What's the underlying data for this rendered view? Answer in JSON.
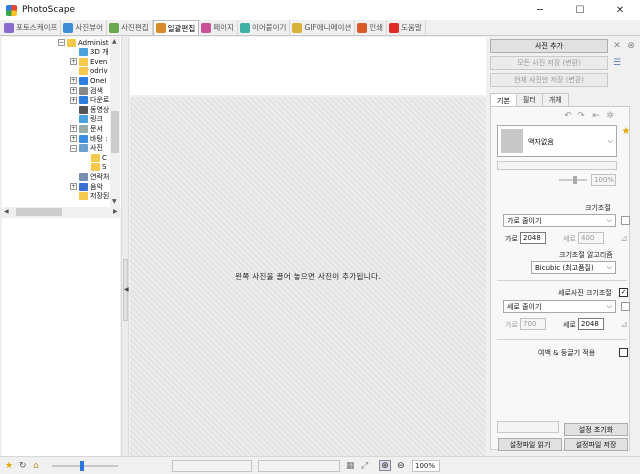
{
  "window": {
    "title": "PhotoScape",
    "minimize": "─",
    "maximize": "☐",
    "close": "✕"
  },
  "tabs": [
    {
      "label": "포토스케이프",
      "color": "#8a6bd0",
      "active": false
    },
    {
      "label": "사진뷰어",
      "color": "#3f8fd8",
      "active": false
    },
    {
      "label": "사진편집",
      "color": "#6aa84f",
      "active": false
    },
    {
      "label": "일괄편집",
      "color": "#d98a2a",
      "active": true
    },
    {
      "label": "페이지",
      "color": "#c94f9a",
      "active": false
    },
    {
      "label": "이어붙이기",
      "color": "#3fb0a8",
      "active": false
    },
    {
      "label": "GIF애니메이션",
      "color": "#d8b23a",
      "active": false
    },
    {
      "label": "인쇄",
      "color": "#d95a2a",
      "active": false
    },
    {
      "label": "도움말",
      "color": "#e02a2a",
      "active": false
    }
  ],
  "tree": {
    "items": [
      {
        "label": "Administ",
        "expander": "−",
        "icon": "user-folder-icon"
      },
      {
        "label": "3D 개",
        "expander": "",
        "icon": "3d-objects-icon"
      },
      {
        "label": "Even",
        "expander": "+",
        "icon": "folder-icon"
      },
      {
        "label": "odriv",
        "expander": "",
        "icon": "folder-icon"
      },
      {
        "label": "OneI",
        "expander": "+",
        "icon": "onedrive-icon"
      },
      {
        "label": "검색",
        "expander": "+",
        "icon": "search-icon"
      },
      {
        "label": "다운로",
        "expander": "+",
        "icon": "download-icon"
      },
      {
        "label": "동영상",
        "expander": "",
        "icon": "video-icon"
      },
      {
        "label": "링크",
        "expander": "",
        "icon": "link-icon"
      },
      {
        "label": "문서",
        "expander": "+",
        "icon": "document-icon"
      },
      {
        "label": "바탕 :",
        "expander": "+",
        "icon": "desktop-icon"
      },
      {
        "label": "사진",
        "expander": "−",
        "icon": "pictures-icon"
      },
      {
        "label": "C",
        "expander": "",
        "icon": "folder-icon"
      },
      {
        "label": "S",
        "expander": "",
        "icon": "folder-icon"
      },
      {
        "label": "연락처",
        "expander": "",
        "icon": "contacts-icon"
      },
      {
        "label": "음악",
        "expander": "+",
        "icon": "music-icon"
      },
      {
        "label": "저장된",
        "expander": "",
        "icon": "folder-icon"
      }
    ]
  },
  "canvas": {
    "hint": "왼쪽 사진을 끌어 놓으면 사진이 추가됩니다."
  },
  "right": {
    "add_photo": "사진 추가",
    "save_all": "모든 사진 저장 (변환)",
    "save_current": "현재 사진만 저장 (변환)",
    "sub_tabs": [
      "기본",
      "필터",
      "개체"
    ],
    "frame_select": "액자없음",
    "frame_opacity": "100%",
    "resize_title": "크기조절",
    "resize_mode": "가로 줄이기",
    "width_label": "가로",
    "width_value": "2048",
    "height_label": "세로",
    "height_value": "400",
    "algo_title": "크기조절 알고리즘",
    "algo_value": "Bicubic (최고품질)",
    "portrait_title": "세로사진 크기조절",
    "portrait_checked": "✓",
    "portrait_mode": "세로 줄이기",
    "p_width_label": "가로",
    "p_width_value": "700",
    "p_height_label": "세로",
    "p_height_value": "2048",
    "margin_label": "여백 & 둥글기 적용",
    "reset_settings": "설정 초기화",
    "load_settings": "설정파일 읽기",
    "save_settings": "설정파일 저장"
  },
  "status": {
    "zoom": "100%"
  }
}
